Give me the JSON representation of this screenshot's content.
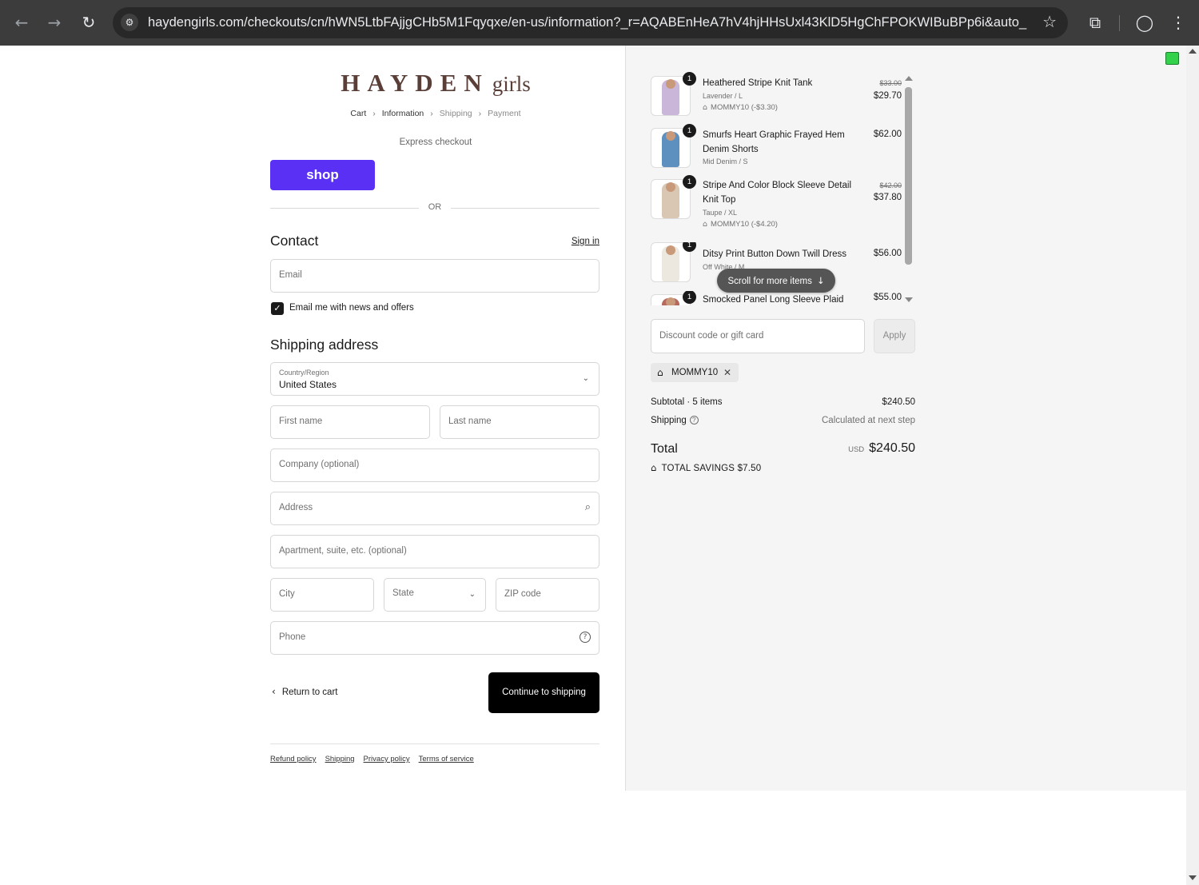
{
  "browser": {
    "url": "haydengirls.com/checkouts/cn/hWN5LtbFAjjgCHb5M1Fqyqxe/en-us/information?_r=AQABEnHeA7hV4hjHHsUxl43KlD5HgChFPOKWIBuBPp6i&auto_re...",
    "back_icon": "←",
    "forward_icon": "→",
    "reload_icon": "↻",
    "site_settings_icon": "⚙",
    "star_icon": "☆",
    "extensions_icon": "⧉",
    "profile_icon": "◯",
    "menu_icon": "⋮"
  },
  "header": {
    "brand": "HAYDEN",
    "brand_sub": "girls",
    "breadcrumb": [
      "Cart",
      "Information",
      "Shipping",
      "Payment"
    ],
    "breadcrumb_sep": "›"
  },
  "express": {
    "title": "Express checkout",
    "shop_label": "shop",
    "or_label": "OR"
  },
  "contact": {
    "title": "Contact",
    "sign_in": "Sign in",
    "email_placeholder": "Email",
    "newsletter_label": "Email me with news and offers",
    "newsletter_checked": true
  },
  "shipping": {
    "title": "Shipping address",
    "country_label": "Country/Region",
    "country_value": "United States",
    "first_name": "First name",
    "last_name": "Last name",
    "company": "Company (optional)",
    "address": "Address",
    "apartment": "Apartment, suite, etc. (optional)",
    "city": "City",
    "state": "State",
    "zip": "ZIP code",
    "phone": "Phone"
  },
  "actions": {
    "return_label": "Return to cart",
    "continue_label": "Continue to shipping"
  },
  "footer": {
    "links": [
      "Refund policy",
      "Shipping",
      "Privacy policy",
      "Terms of service"
    ]
  },
  "cart": {
    "items": [
      {
        "qty": "1",
        "name": "Heathered Stripe Knit Tank",
        "variant": "Lavender / L",
        "discount": "MOMMY10 (-$3.30)",
        "original": "$33.00",
        "price": "$29.70"
      },
      {
        "qty": "1",
        "name": "Smurfs Heart Graphic Frayed Hem Denim Shorts",
        "variant": "Mid Denim / S",
        "discount": "",
        "original": "",
        "price": "$62.00"
      },
      {
        "qty": "1",
        "name": "Stripe And Color Block Sleeve Detail Knit Top",
        "variant": "Taupe / XL",
        "discount": "MOMMY10 (-$4.20)",
        "original": "$42.00",
        "price": "$37.80"
      },
      {
        "qty": "1",
        "name": "Ditsy Print Button Down Twill Dress",
        "variant": "Off White / M",
        "discount": "",
        "original": "",
        "price": "$56.00"
      },
      {
        "qty": "1",
        "name": "Smocked Panel Long Sleeve Plaid",
        "variant": "",
        "discount": "",
        "original": "",
        "price": "$55.00"
      }
    ],
    "scroll_hint": "Scroll for more items",
    "discount_placeholder": "Discount code or gift card",
    "apply_label": "Apply",
    "applied_code": "MOMMY10",
    "subtotal_label": "Subtotal · 5 items",
    "subtotal_value": "$240.50",
    "shipping_label": "Shipping",
    "shipping_value": "Calculated at next step",
    "total_label": "Total",
    "currency": "USD",
    "total_value": "$240.50",
    "savings_label": "TOTAL SAVINGS",
    "savings_value": "$7.50"
  },
  "colors": {
    "shop_pay": "#5a31f4",
    "logo": "#5a3f38",
    "extension_indicator": "#33d24a"
  }
}
